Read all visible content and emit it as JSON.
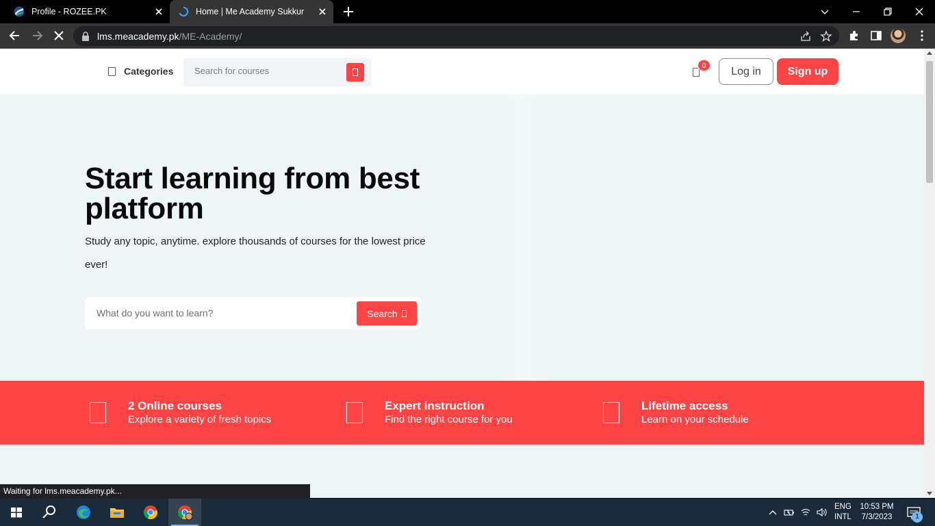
{
  "browser": {
    "tabs": [
      {
        "title": "Profile - ROZEE.PK",
        "favicon": "rozee-favicon",
        "active": false
      },
      {
        "title": "Home | Me Academy Sukkur",
        "favicon": "loading-spinner",
        "active": true
      }
    ],
    "url_host": "lms.meacademy.pk",
    "url_path": "/ME-Academy/",
    "status_text": "Waiting for lms.meacademy.pk..."
  },
  "header": {
    "categories_label": "Categories",
    "search_placeholder": "Search for courses",
    "cart_count": "0",
    "login_label": "Log in",
    "signup_label": "Sign up"
  },
  "hero": {
    "title": "Start learning from best platform",
    "subtitle": "Study any topic, anytime. explore thousands of courses for the lowest price ever!",
    "search_placeholder": "What do you want to learn?",
    "search_button": "Search"
  },
  "features": [
    {
      "title": "2 Online courses",
      "desc": "Explore a variety of fresh topics"
    },
    {
      "title": "Expert instruction",
      "desc": "Find the right course for you"
    },
    {
      "title": "Lifetime access",
      "desc": "Learn on your schedule"
    }
  ],
  "taskbar": {
    "lang_line1": "ENG",
    "lang_line2": "INTL",
    "time": "10:53 PM",
    "date": "7/3/2023",
    "notification_count": "1"
  },
  "colors": {
    "brand_red": "#fc4445",
    "hero_bg": "#eef5f7",
    "browser_dark": "#353535",
    "taskbar": "#1b2a3a"
  }
}
